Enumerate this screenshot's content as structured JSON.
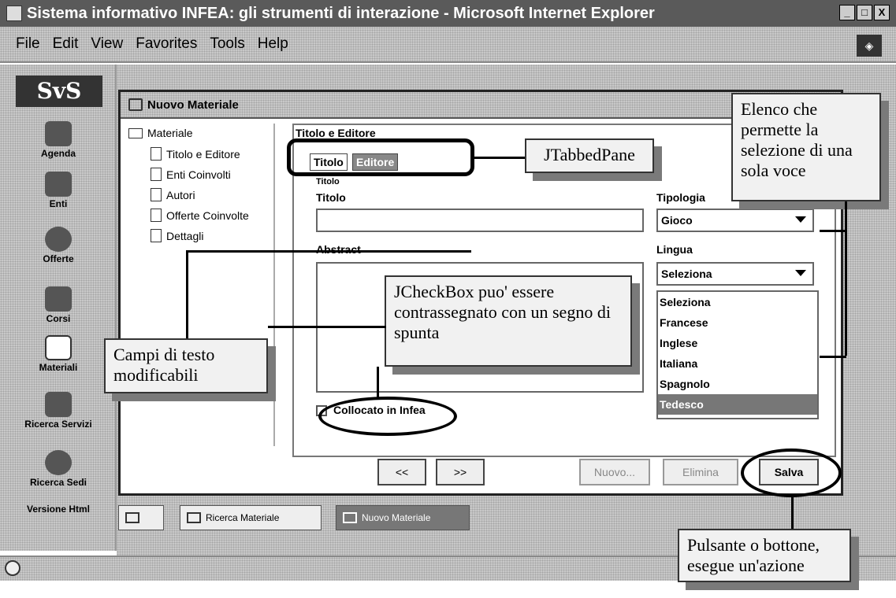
{
  "window": {
    "title": "Sistema informativo INFEA: gli strumenti di interazione - Microsoft Internet Explorer",
    "buttons": [
      "_",
      "□",
      "X"
    ]
  },
  "menu": [
    "File",
    "Edit",
    "View",
    "Favorites",
    "Tools",
    "Help"
  ],
  "nav": {
    "logo": "SvS",
    "items": [
      "Agenda",
      "Enti",
      "Offerte",
      "Corsi",
      "Materiali",
      "Ricerca Servizi",
      "Ricerca Sedi",
      "Versione Html"
    ],
    "icons": [
      "calendar-icon",
      "phone-icon",
      "heart-icon",
      "teacher-icon",
      "book-icon",
      "grid-icon",
      "globe-icon"
    ]
  },
  "frame": {
    "title": "Nuovo Materiale",
    "tree": {
      "root": "Materiale",
      "children": [
        "Titolo e Editore",
        "Enti Coinvolti",
        "Autori",
        "Offerte Coinvolte",
        "Dettagli"
      ]
    },
    "section_title": "Titolo e Editore",
    "tabs": [
      "Titolo",
      "Editore"
    ],
    "group_label": "Titolo",
    "title_label": "Titolo",
    "title_value": "",
    "abstract_label": "Abstract",
    "abstract_value": "",
    "checkbox_label": "Collocato in Infea",
    "tipologia": {
      "label": "Tipologia",
      "value": "Gioco"
    },
    "lingua": {
      "label": "Lingua",
      "value": "Seleziona",
      "options": [
        "Seleziona",
        "Francese",
        "Inglese",
        "Italiana",
        "Spagnolo",
        "Tedesco"
      ],
      "selected": "Tedesco"
    },
    "buttons": {
      "prev": "<<",
      "next": ">>",
      "new": "Nuovo...",
      "delete": "Elimina",
      "save": "Salva"
    }
  },
  "taskbar": {
    "items": [
      "Ricerca Materiale",
      "Nuovo Materiale"
    ]
  },
  "annotations": {
    "tabbed": "JTabbedPane",
    "list": "Elenco che permette la selezione di una sola voce",
    "checkbox": "JCheckBox puo' essere contrassegnato con un segno di spunta",
    "textfields": "Campi di testo modificabili",
    "button": "Pulsante o bottone, esegue un'azione"
  }
}
